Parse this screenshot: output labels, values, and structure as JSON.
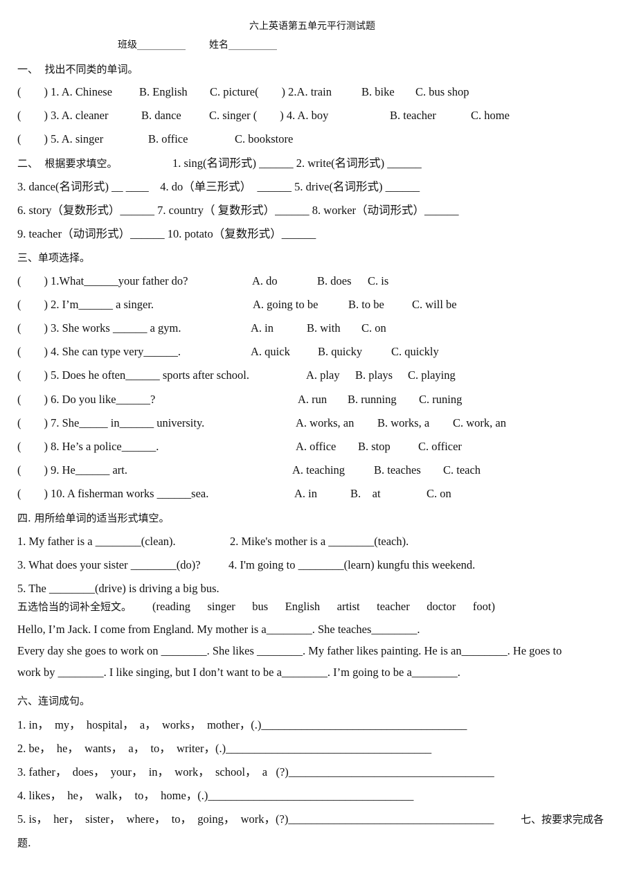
{
  "header": {
    "title": "六上英语第五单元平行测试题",
    "class_label": "班级__________",
    "name_label": "姓名__________"
  },
  "section1": {
    "heading": "一、  找出不同类的单词。",
    "rows": [
      [
        {
          "text": "(        ) 1. A. Chinese"
        },
        {
          "text": "B. English"
        },
        {
          "text": "C. picture(        ) 2.A. train"
        },
        {
          "text": "B. bike"
        },
        {
          "text": "C. bus shop"
        }
      ],
      [
        {
          "text": "(        ) 3. A. cleaner"
        },
        {
          "text": "B. dance"
        },
        {
          "text": "C. singer (        ) 4. A. boy"
        },
        {
          "text": "B. teacher"
        },
        {
          "text": "C. home"
        }
      ],
      [
        {
          "text": "(        ) 5. A. singer"
        },
        {
          "text": "B. office"
        },
        {
          "text": "C. bookstore"
        }
      ]
    ]
  },
  "section2": {
    "heading": "二、  根据要求填空。",
    "lines": [
      "1. sing(名词形式) ______ 2. write(名词形式) ______",
      "3. dance(名词形式) __ ____    4. do（单三形式）  ______ 5. drive(名词形式) ______",
      "6. story（复数形式）______ 7. country（ 复数形式）______ 8. worker（动词形式）______",
      "9. teacher（动词形式）______ 10. potato（复数形式）______"
    ]
  },
  "section3": {
    "heading": "三、单项选择。",
    "questions": [
      {
        "q": "(        ) 1.What______your father do?",
        "a": "A. do",
        "b": "B. does",
        "c": "C. is"
      },
      {
        "q": "(        ) 2. I’m______ a singer.",
        "a": "A. going to be",
        "b": "B. to be",
        "c": "C. will be"
      },
      {
        "q": "(        ) 3. She works ______ a gym.",
        "a": "A. in",
        "b": "B. with",
        "c": "C. on"
      },
      {
        "q": "(        ) 4. She can type very______.",
        "a": "A. quick",
        "b": "B. quicky",
        "c": "C. quickly"
      },
      {
        "q": "(        ) 5. Does he often______ sports after school.",
        "a": "A. play",
        "b": "B. plays",
        "c": "C. playing"
      },
      {
        "q": "(        ) 6. Do you like______?",
        "a": "A. run",
        "b": "B. running",
        "c": "C. runing"
      },
      {
        "q": "(        ) 7. She_____ in______ university.",
        "a": "A. works, an",
        "b": "B. works, a",
        "c": "C. work, an"
      },
      {
        "q": "(        ) 8. He’s a police______.",
        "a": "A. office",
        "b": "B. stop",
        "c": "C. officer"
      },
      {
        "q": "(        ) 9. He______ art.",
        "a": "A. teaching",
        "b": "B. teaches",
        "c": "C. teach"
      },
      {
        "q": "(        ) 10. A fisherman works ______sea.",
        "a": "A. in",
        "b": "B.    at",
        "c": "C. on"
      }
    ]
  },
  "section4": {
    "heading": "四. 用所给单词的适当形式填空。",
    "lines": [
      [
        "1. My father is a ________(clean).",
        "2. Mike's mother is a ________(teach)."
      ],
      [
        "3. What does your sister ________(do)?",
        "4. I'm going to ________(learn) kungfu this weekend."
      ],
      [
        "5. The ________(drive) is driving a big bus."
      ]
    ]
  },
  "section5": {
    "heading": "五选恰当的词补全短文。",
    "word_bank": "(reading    singer    bus    English    artist    teacher    doctor    foot)",
    "passage": [
      "Hello, I’m Jack. I come from England. My mother is a________. She teaches________.",
      "Every day she goes to work on ________. She likes ________. My father likes painting. He is an________. He goes to",
      "work by ________. I like singing, but I don’t want to be a________. I’m going to be a________."
    ]
  },
  "section6": {
    "heading": "六、连词成句。",
    "items": [
      {
        "words": "1. in，  my，  hospital，  a，  works，  mother，(.)",
        "line": "____________________________________"
      },
      {
        "words": "2. be，  he，  wants，  a，  to，  writer，(.)",
        "line": "____________________________________"
      },
      {
        "words": "3. father，  does，  your，  in，  work，  school，  a   (?)",
        "line": "____________________________________"
      },
      {
        "words": "4. likes，  he，  walk，  to，  home，(.)",
        "line": "____________________________________"
      },
      {
        "words": "5. is，  her，  sister，  where，  to，  going，  work，(?)",
        "line": "____________________________________"
      }
    ]
  },
  "section7": {
    "heading_part1": "七、按要求完成各",
    "heading_part2": "题."
  }
}
